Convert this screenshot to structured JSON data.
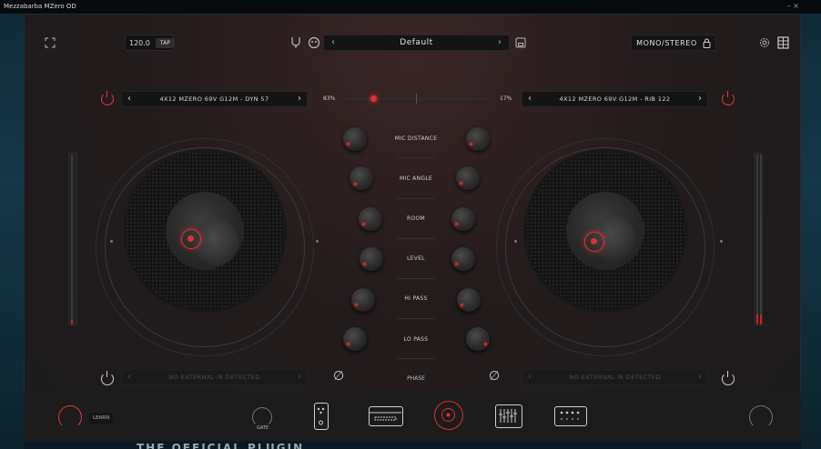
{
  "app": {
    "title": "Mezzabarba MZero OD",
    "window_controls": "– ×"
  },
  "toolbar": {
    "tempo": "120.0",
    "tap_label": "TAP",
    "preset_name": "Default",
    "prev_arrow": "‹",
    "next_arrow": "›",
    "mono_stereo": "MONO/STEREO"
  },
  "cab_a": {
    "ir_name": "4X12 MZERO 69V G12M - DYN 57",
    "ext_ir": "NO EXTERNAL IR DETECTED"
  },
  "cab_b": {
    "ir_name": "4X12 MZERO 69V G12M - RIB 122",
    "ext_ir": "NO EXTERNAL IR DETECTED"
  },
  "mix": {
    "left_pct": "83%",
    "right_pct": "17%",
    "balance": 0.83
  },
  "params": {
    "mic_distance": "MIC DISTANCE",
    "mic_angle": "MIC ANGLE",
    "room": "ROOM",
    "level": "LEVEL",
    "hi_pass": "HI PASS",
    "lo_pass": "LO PASS",
    "phase": "PHASE"
  },
  "phase_symbol": "∅",
  "bottom": {
    "learn": "LEARN",
    "gate": "GATE"
  },
  "background_text": "THE OFFICIAL PLUGIN",
  "colors": {
    "accent": "#e02b2b",
    "panel": "#1b1b1c"
  }
}
